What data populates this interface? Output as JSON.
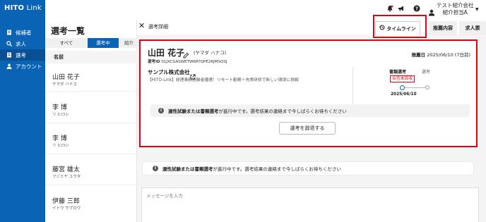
{
  "header": {
    "logo_text": "HITO",
    "logo_suffix": " Link",
    "icons": [
      "bell-icon",
      "megaphone-icon",
      "help-icon"
    ],
    "company_line1": "テスト紹介会社",
    "company_line2": "紹介担当A",
    "caret": "▼"
  },
  "sidebar": {
    "items": [
      {
        "label": "候補者",
        "icon": "candidate-icon",
        "active": false
      },
      {
        "label": "求人",
        "icon": "job-icon",
        "active": false
      },
      {
        "label": "選考",
        "icon": "selection-icon",
        "active": true
      },
      {
        "label": "アカウント",
        "icon": "account-icon",
        "active": false
      }
    ]
  },
  "list": {
    "title": "選考一覧",
    "tabs": [
      "すべて",
      "選考中",
      "紹介"
    ],
    "column_header": "名前",
    "rows": [
      {
        "name": "山田 花子",
        "kana": "ヤマダ ハナコ"
      },
      {
        "name": "李 博",
        "kana": "リ ヒロシ"
      },
      {
        "name": "李 博",
        "kana": "リ ヒロシ"
      },
      {
        "name": "藤宮 雄太",
        "kana": "フジミヤ ユウタ"
      },
      {
        "name": "伊藤 三郎",
        "kana": "イトウ サブロウ"
      }
    ]
  },
  "detail": {
    "close": "✕",
    "title": "選考詳細",
    "tabs": {
      "timeline": "タイムライン",
      "recommendation": "推薦内容",
      "job": "求人票"
    },
    "candidate_name": "山田 花子",
    "candidate_kana": "(ヤマダ ハナコ)",
    "selection_id_label": "選考ID",
    "selection_id": "01JXCGASWETW6RTQPE2RJMSQSJ",
    "reco_date_label": "推薦日",
    "reco_date": "2025/06/10 (7日前)",
    "company": "サンプル株式会社",
    "job_title": "【HITO-Link】経理事務経験者優遇！リモート勤務＋充実研修で新しい環境に挑戦",
    "stage_current": "書類選考",
    "stage_next": "選考",
    "stage_badge": "合否未回収",
    "stage_date": "2025/06/10",
    "notice_bold": "適性試験または書類選考",
    "notice_rest": "が進行中です。選考結果の連絡まで今しばらくお待ちください",
    "report_button": "選考を辞退する",
    "message_placeholder": "メッセージを入力"
  },
  "colors": {
    "brand": "#0b63b6",
    "highlight": "#e3000f"
  }
}
